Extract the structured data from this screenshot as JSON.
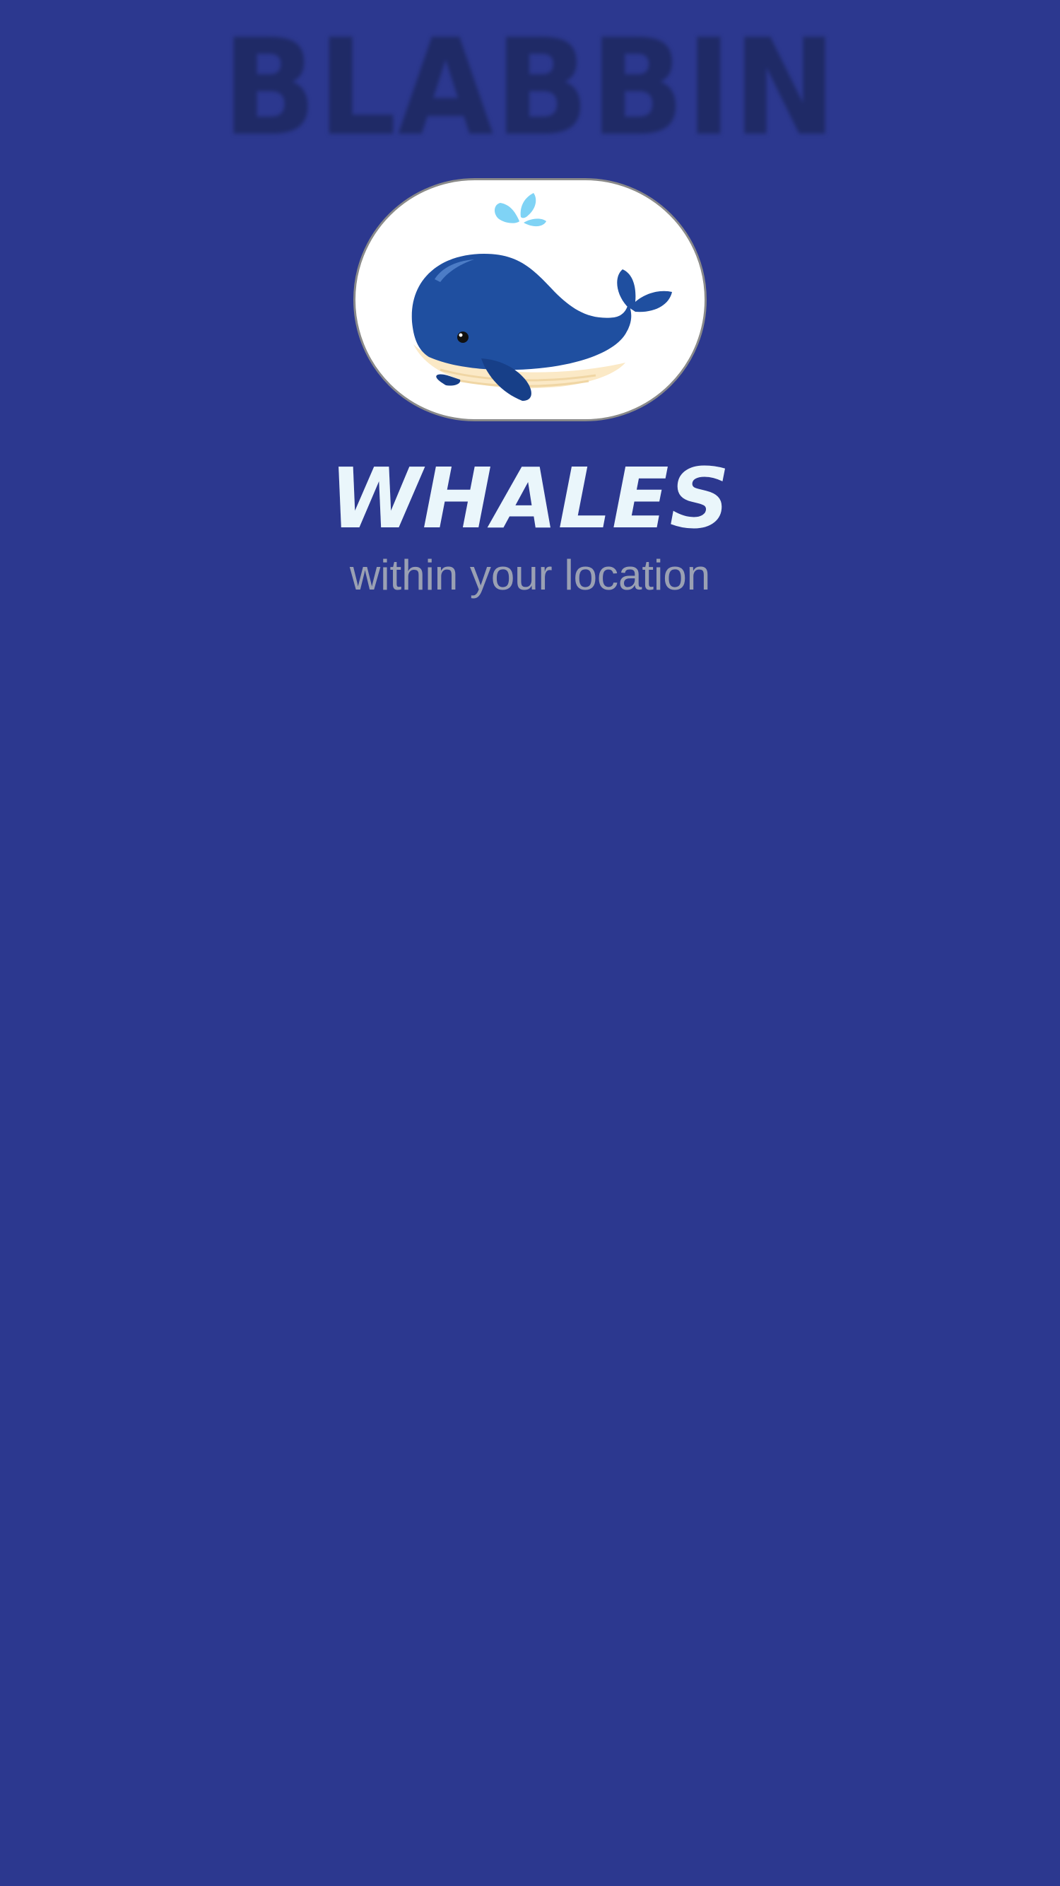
{
  "app": {
    "logo_text": "BLABBIN"
  },
  "card": {
    "image_icon": "whale-icon",
    "title": "WHALES",
    "subtitle": "within your location"
  },
  "colors": {
    "background": "#2c388f",
    "logo": "#1f2a66",
    "title": "#eaf6fb",
    "subtitle": "#9aa0b3",
    "whale_body": "#1f4fa0",
    "whale_belly": "#fbe9c6",
    "water_spout": "#7fd3f5"
  }
}
